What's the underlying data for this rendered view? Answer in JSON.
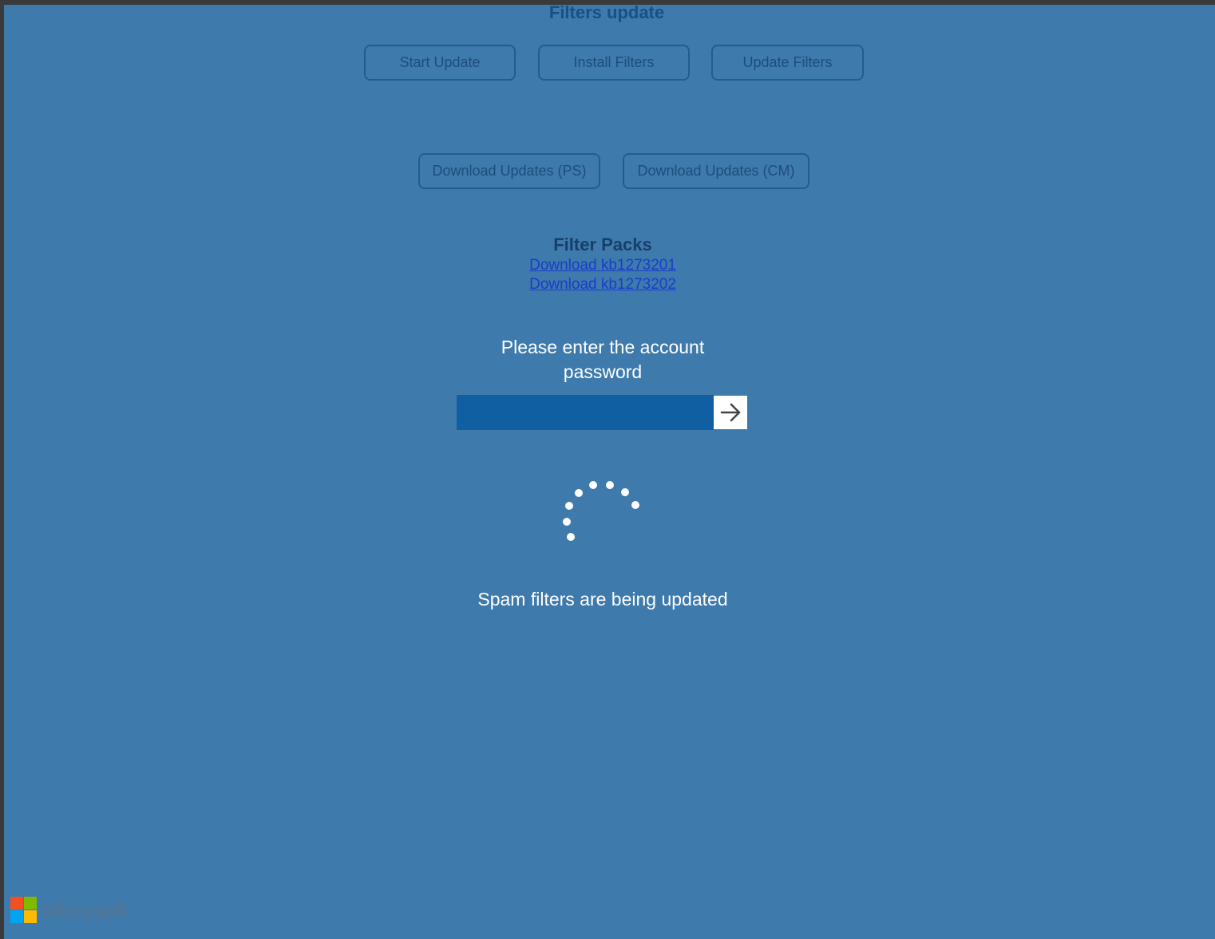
{
  "header": {
    "title": "Filters update"
  },
  "toolbar": {
    "start_update_label": "Start Update",
    "install_filters_label": "Install Filters",
    "update_filters_label": "Update Filters",
    "download_ps_label": "Download Updates (PS)",
    "download_cm_label": "Download Updates (CM)"
  },
  "filter_packs": {
    "heading": "Filter Packs",
    "links": [
      {
        "label": "Download kb1273201"
      },
      {
        "label": "Download kb1273202"
      }
    ]
  },
  "login": {
    "prompt": "Please enter the account password",
    "password_value": "",
    "submit_icon": "arrow-right-icon"
  },
  "status": {
    "message": "Spam filters are being updated",
    "spinner_icon": "loading-spinner-icon"
  },
  "footer": {
    "brand": "Microsoft",
    "logo_colors": [
      "#f25022",
      "#7fba00",
      "#00a4ef",
      "#ffb900"
    ]
  },
  "colors": {
    "background": "#3e7aab",
    "input_fill": "#0f5fa2",
    "link": "#1b3ccc"
  }
}
